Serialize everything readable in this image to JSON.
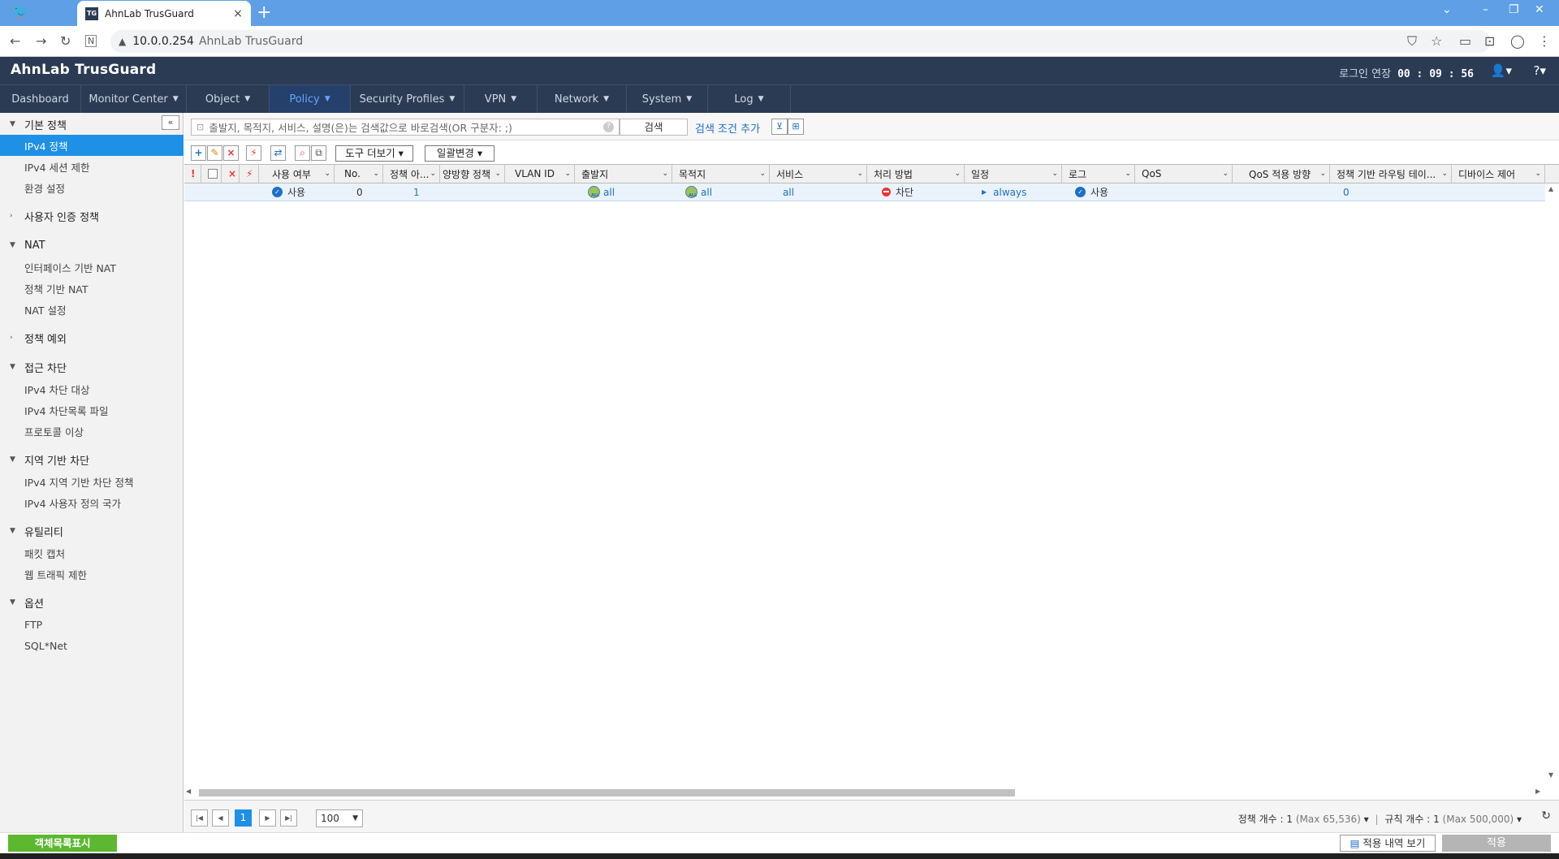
{
  "browser": {
    "tab_title": "AhnLab TrusGuard",
    "favicon_text": "TG",
    "new_tab": "+",
    "url_host": "10.0.0.254",
    "url_title": "AhnLab TrusGuard"
  },
  "header": {
    "brand": "AhnLab TrusGuard",
    "session_label": "로그인 연장",
    "session_time": "00 : 09 : 56"
  },
  "menu": [
    "Dashboard",
    "Monitor Center",
    "Object",
    "Policy",
    "Security Profiles",
    "VPN",
    "Network",
    "System",
    "Log"
  ],
  "sidebar": {
    "groups": [
      {
        "label": "기본 정책"
      },
      {
        "label": "사용자 인증 정책"
      },
      {
        "label": "NAT"
      },
      {
        "label": "정책 예외"
      },
      {
        "label": "접근 차단"
      },
      {
        "label": "지역 기반 차단"
      },
      {
        "label": "유틸리티"
      },
      {
        "label": "옵션"
      }
    ],
    "items": [
      {
        "label": "IPv4 정책"
      },
      {
        "label": "IPv4 세션 제한"
      },
      {
        "label": "환경 설정"
      },
      {
        "label": "인터페이스 기반 NAT"
      },
      {
        "label": "정책 기반 NAT"
      },
      {
        "label": "NAT 설정"
      },
      {
        "label": "IPv4 차단 대상"
      },
      {
        "label": "IPv4 차단목록 파일"
      },
      {
        "label": "프로토콜 이상"
      },
      {
        "label": "IPv4 지역 기반 차단 정책"
      },
      {
        "label": "IPv4 사용자 정의 국가"
      },
      {
        "label": "패킷 캡처"
      },
      {
        "label": "웹 트래픽 제한"
      },
      {
        "label": "FTP"
      },
      {
        "label": "SQL*Net"
      }
    ]
  },
  "search": {
    "placeholder": "출발지, 목적지, 서비스, 설명(은)는 검색값으로 바로검색(OR 구분자: ;)",
    "button": "검색",
    "add_condition": "검색 조건 추가"
  },
  "toolbar": {
    "more_tools": "도구 더보기",
    "bulk_change": "일괄변경"
  },
  "columns": [
    "사용 여부",
    "No.",
    "정책 아...",
    "양방향 정책",
    "VLAN ID",
    "출발지",
    "목적지",
    "서비스",
    "처리 방법",
    "일정",
    "로그",
    "QoS",
    "QoS 적용 방향",
    "정책 기반 라우팅 테이...",
    "디바이스 제어"
  ],
  "rows": [
    {
      "enabled": "사용",
      "no": "0",
      "policy_id": "1",
      "bidirectional": "",
      "vlan": "",
      "source": "all",
      "destination": "all",
      "service": "all",
      "action": "차단",
      "schedule": "always",
      "log": "사용",
      "qos": "",
      "qos_dir": "",
      "pbr": "0",
      "device": ""
    }
  ],
  "pager": {
    "current_page": "1",
    "page_size": "100",
    "policy_count_label": "정책 개수 :",
    "policy_count": "1",
    "policy_max": "(Max 65,536)",
    "rule_count_label": "규칙 개수 :",
    "rule_count": "1",
    "rule_max": "(Max 500,000)"
  },
  "bottom": {
    "object_list": "객체목록표시",
    "apply_history": "적용 내역 보기",
    "apply": "적용"
  },
  "colors": {
    "header_bg": "#2b3b54",
    "accent": "#1e90e6",
    "link": "#1e6fc8",
    "deny": "#ee3333",
    "object_list_green": "#5bb82f"
  }
}
